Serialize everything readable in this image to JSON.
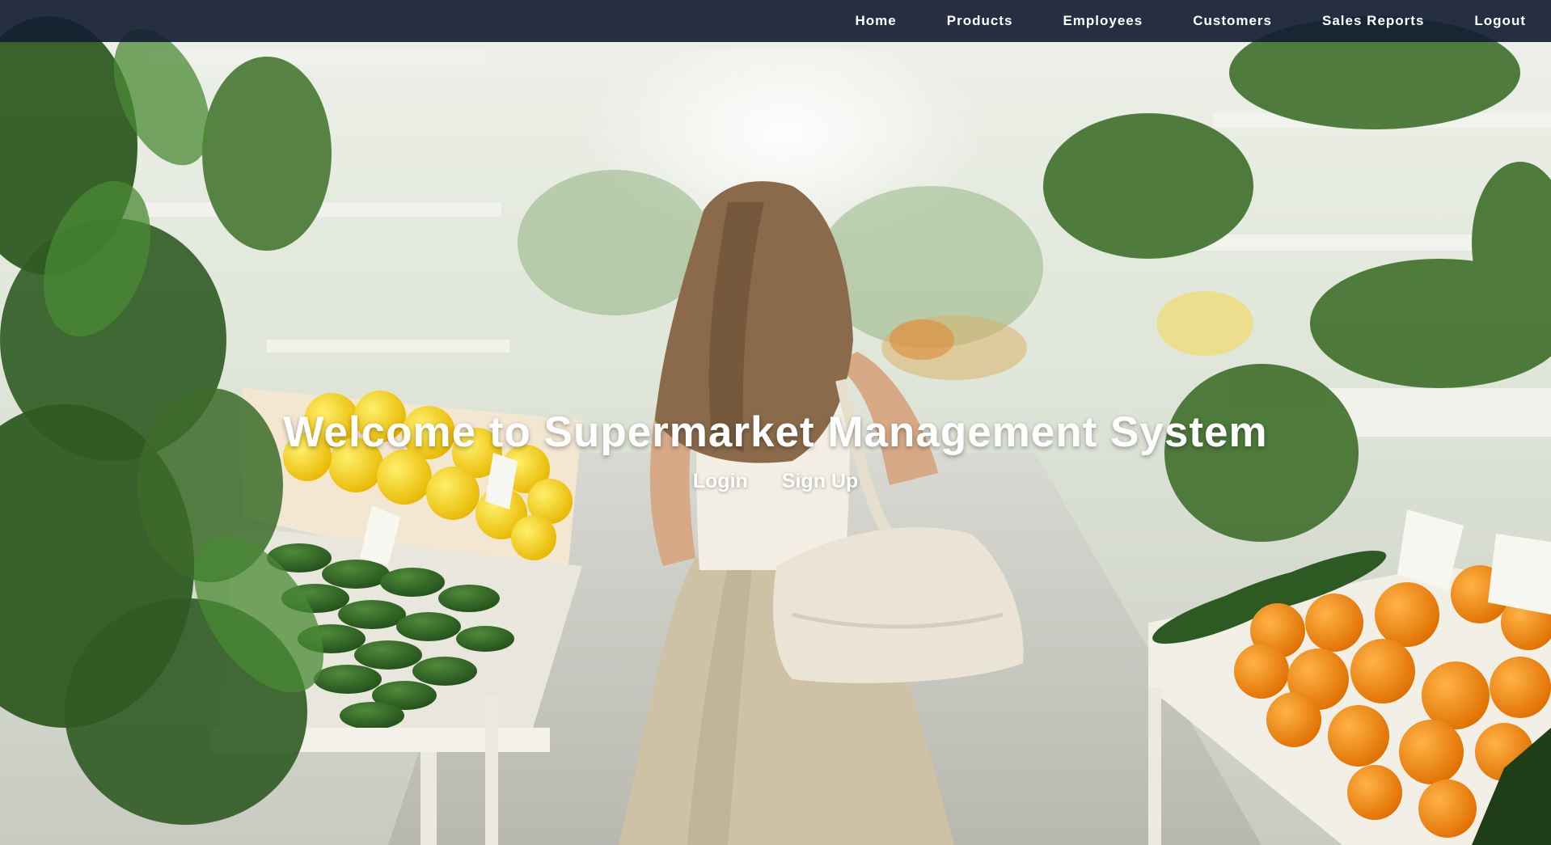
{
  "nav": {
    "items": [
      {
        "label": "Home"
      },
      {
        "label": "Products"
      },
      {
        "label": "Employees"
      },
      {
        "label": "Customers"
      },
      {
        "label": "Sales Reports"
      },
      {
        "label": "Logout"
      }
    ]
  },
  "hero": {
    "title": "Welcome to Supermarket Management System",
    "login_label": "Login",
    "signup_label": "Sign Up",
    "background": "supermarket-produce-aisle-photo"
  },
  "colors": {
    "navbar": "#141e32",
    "text": "#ffffff"
  }
}
